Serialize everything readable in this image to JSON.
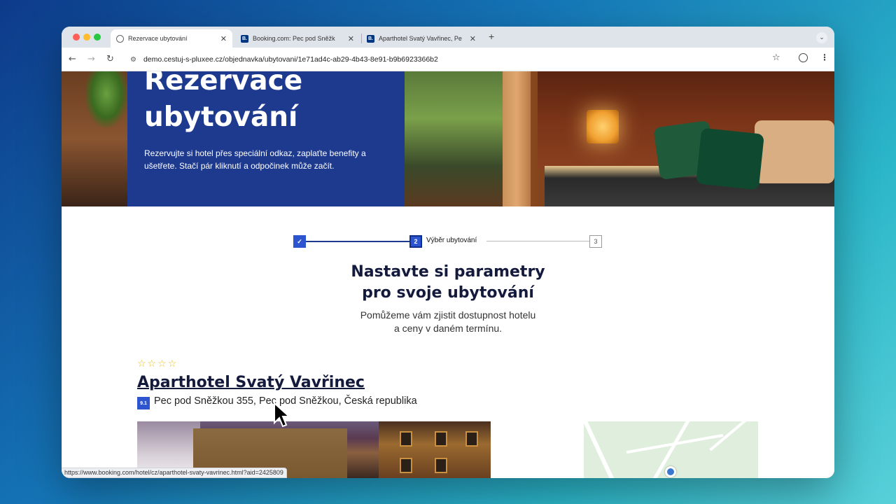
{
  "browser": {
    "tabs": [
      {
        "title": "Rezervace ubytování",
        "favicon": "globe-icon",
        "active": true
      },
      {
        "title": "Booking.com: Pec pod Sněžk",
        "favicon": "booking-icon",
        "active": false
      },
      {
        "title": "Aparthotel Svatý Vavřinec, Pe",
        "favicon": "booking-icon",
        "active": false
      }
    ],
    "new_tab_label": "+",
    "url": "demo.cestuj-s-pluxee.cz/objednavka/ubytovani/1e71ad4c-ab29-4b43-8e91-b9b6923366b2",
    "status_url": "https://www.booking.com/hotel/cz/aparthotel-svaty-vavrinec.html?aid=2425809"
  },
  "hero": {
    "title_line1": "Rezervace",
    "title_line2": "ubytování",
    "description": "Rezervujte si hotel přes speciální odkaz, zaplaťte benefity a ušetřete. Stačí pár kliknutí a odpočinek může začít."
  },
  "stepper": {
    "step1_icon": "check-icon",
    "step2_number": "2",
    "step2_label": "Výběr ubytování",
    "step3_number": "3"
  },
  "main": {
    "title_line1": "Nastavte si parametry",
    "title_line2": "pro svoje ubytování",
    "subtitle_line1": "Pomůžeme vám zjistit dostupnost hotelu",
    "subtitle_line2": "a ceny v daném termínu."
  },
  "hotel": {
    "stars": "☆☆☆☆",
    "name": "Aparthotel Svatý Vavřinec",
    "rating": "9.1",
    "address": "Pec pod Sněžkou 355, Pec pod Sněžkou, Česká republika"
  },
  "colors": {
    "brand_blue": "#1e3a8f",
    "accent_blue": "#2d55d0",
    "heading_dark": "#141a3c",
    "star_yellow": "#e8c020"
  }
}
